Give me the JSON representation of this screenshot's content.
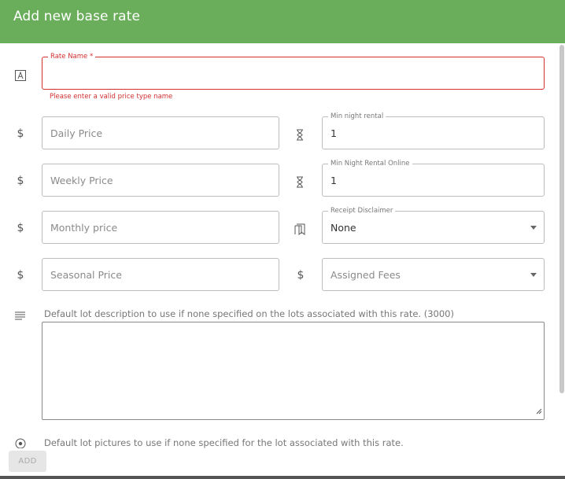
{
  "dialog": {
    "title": "Add new base rate",
    "add_label": "ADD"
  },
  "form": {
    "rate_name": {
      "label": "Rate Name *",
      "value": "",
      "error": "Please enter a valid price type name"
    },
    "daily_price": {
      "placeholder": "Daily Price",
      "value": ""
    },
    "weekly_price": {
      "placeholder": "Weekly Price",
      "value": ""
    },
    "monthly_price": {
      "placeholder": "Monthly price",
      "value": ""
    },
    "seasonal_price": {
      "placeholder": "Seasonal Price",
      "value": ""
    },
    "min_night_rental": {
      "label": "Min night rental",
      "value": "1"
    },
    "min_night_rental_online": {
      "label": "Min Night Rental Online",
      "value": "1"
    },
    "receipt_disclaimer": {
      "label": "Receipt Disclaimer",
      "value": "None"
    },
    "assigned_fees": {
      "placeholder": "Assigned Fees"
    },
    "description": {
      "label": "Default lot description to use if none specified on the lots associated with this rate. (3000)",
      "value": ""
    },
    "pictures": {
      "label": "Default lot pictures to use if none specified for the lot associated with this rate."
    }
  },
  "icons": {
    "rate_name": "text-field-icon",
    "currency": "dollar-icon",
    "min_nights": "hourglass-icon",
    "receipt": "bookmark-icon",
    "description": "notes-icon",
    "pictures": "image-icon"
  },
  "colors": {
    "header": "#6aae5b",
    "error": "#d32f2f"
  }
}
